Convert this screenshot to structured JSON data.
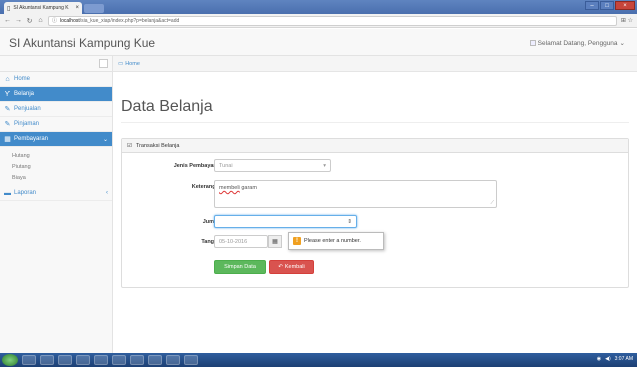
{
  "browser": {
    "tab_title": "SI Akuntansi Kampung K",
    "tab_close": "×",
    "url_host": "localhost",
    "url_path": "/sia_kue_xiap/index.php?p=belanja&act=add",
    "right_icons": "⊞ ☆"
  },
  "header": {
    "brand": "SI Akuntansi Kampung Kue",
    "welcome": "Selamat Datang, Pengguna",
    "welcome_caret": "⌄"
  },
  "sidebar": {
    "items": [
      {
        "label": "Home",
        "icon": "home-icon"
      },
      {
        "label": "Belanja",
        "icon": "cart-icon"
      },
      {
        "label": "Penjualan",
        "icon": "edit-icon"
      },
      {
        "label": "Pinjaman",
        "icon": "edit-icon"
      },
      {
        "label": "Pembayaran",
        "icon": "grid-icon"
      }
    ],
    "sub_items": [
      "Hutang",
      "Piutang",
      "Biaya"
    ],
    "laporan": "Laporan",
    "chev_open": "⌄",
    "chev_closed": "‹"
  },
  "breadcrumb": {
    "label": "Home"
  },
  "page": {
    "title": "Data Belanja"
  },
  "panel": {
    "title": "Transaksi Belanja"
  },
  "form": {
    "jenis_label": "Jenis Pembayaran",
    "jenis_value": "Tunai",
    "keterangan_label": "Keterangan",
    "keterangan_word1": "membeli",
    "keterangan_word2": "garam",
    "jumlah_label": "Jumlah",
    "jumlah_spin": "⇕",
    "tanggal_label": "Tanggal",
    "tanggal_value": "05-10-2016",
    "tooltip_text": "Please enter a number.",
    "tooltip_mark": "!"
  },
  "buttons": {
    "save": "Simpan Data",
    "back": "Kembali"
  },
  "taskbar": {
    "clock": "3:07 AM"
  },
  "colors": {
    "primary": "#428bca",
    "success": "#5cb85c",
    "danger": "#d9534f",
    "taskbar": "#1c3f73"
  }
}
